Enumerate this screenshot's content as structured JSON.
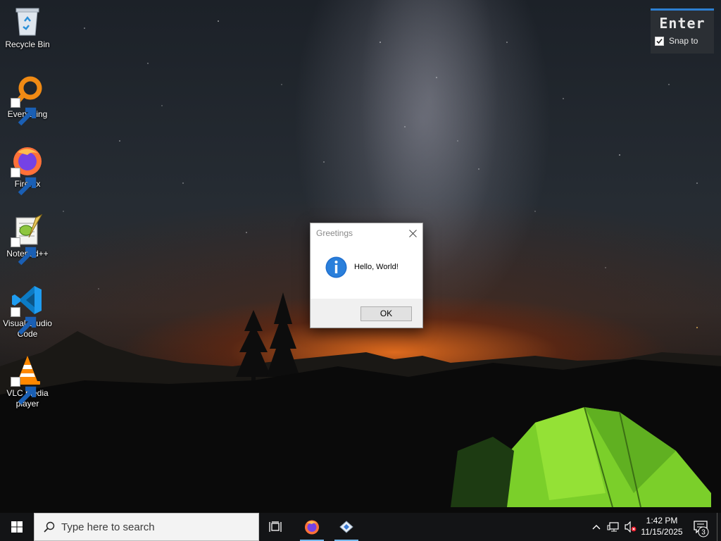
{
  "desktop": {
    "icons": [
      {
        "label": "Recycle Bin",
        "icon": "recycle-bin-icon"
      },
      {
        "label": "Everything",
        "icon": "everything-search-icon"
      },
      {
        "label": "Firefox",
        "icon": "firefox-icon"
      },
      {
        "label": "Notepad++",
        "icon": "notepad-plus-plus-icon"
      },
      {
        "label": "Visual Studio Code",
        "icon": "vscode-icon"
      },
      {
        "label": "VLC media player",
        "icon": "vlc-icon"
      }
    ]
  },
  "overlay": {
    "title": "Enter",
    "snap_label": "Snap to",
    "snap_checked": true
  },
  "dialog": {
    "title": "Greetings",
    "message": "Hello, World!",
    "ok_label": "OK",
    "icon": "information-icon"
  },
  "taskbar": {
    "search_placeholder": "Type here to search",
    "pinned": [
      "task-view-icon",
      "firefox-icon",
      "python-app-icon"
    ],
    "clock_time": "1:42 PM",
    "clock_date": "11/15/2025",
    "notification_count": "3",
    "accent_color": "#76b9ed"
  }
}
